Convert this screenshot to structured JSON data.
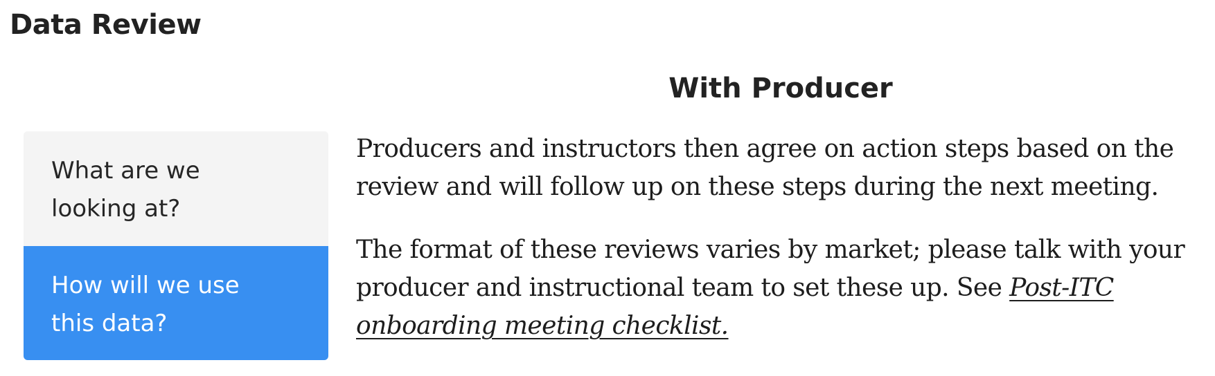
{
  "page": {
    "title": "Data Review"
  },
  "tabs": [
    {
      "line1": "What are we",
      "line2": "looking at?",
      "selected": false
    },
    {
      "line1": "How will we use",
      "line2": "this data?",
      "selected": true
    }
  ],
  "section": {
    "heading": "With Producer",
    "paragraph1": {
      "line1": "Producers and instructors then agree on action steps based on the",
      "line2": "review and will follow up on these steps during the next meeting."
    },
    "paragraph2": {
      "line1": "The format of these reviews varies by market; please talk with your",
      "line2_text": "producer and instructional team to set these up. See ",
      "link_part1": "Post-ITC",
      "link_part2": "onboarding meeting checklist."
    }
  },
  "colors": {
    "tab_inactive_bg": "#f4f4f4",
    "tab_active_bg": "#388ff1",
    "tab_active_text": "#ffffff",
    "text": "#1d1d1d"
  }
}
